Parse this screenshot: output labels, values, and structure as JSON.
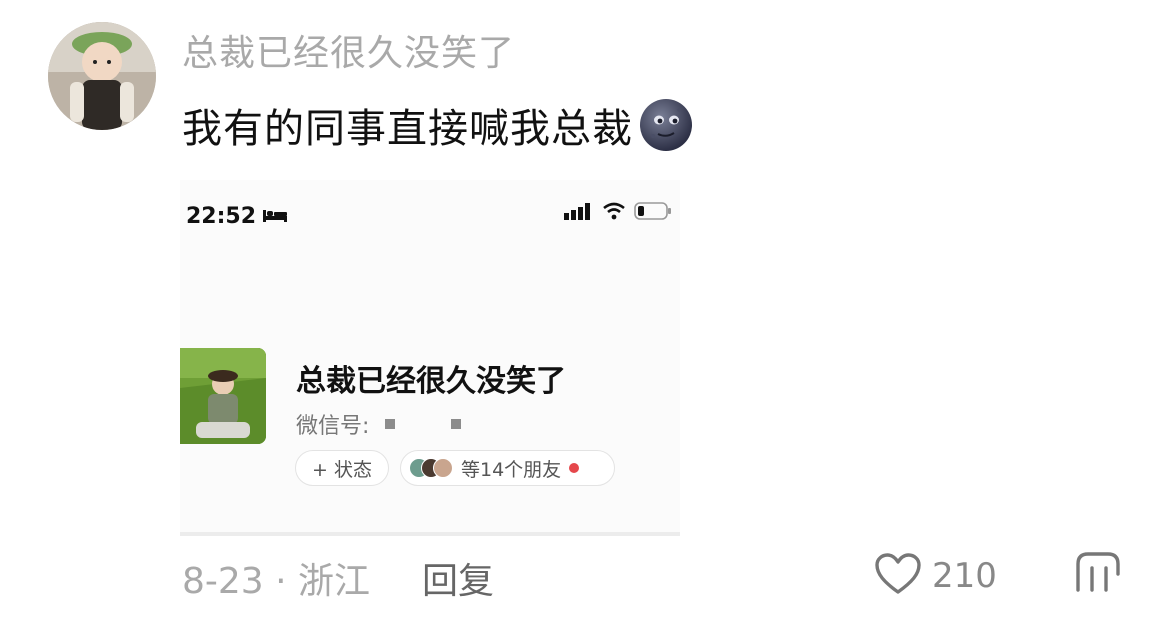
{
  "comment": {
    "username": "总裁已经很久没笑了",
    "text": "我有的同事直接喊我总裁",
    "emoji": "moon-face-emoji"
  },
  "screenshot": {
    "status_bar": {
      "time": "22:52"
    },
    "profile": {
      "name": "总裁已经很久没笑了",
      "wechat_id_label": "微信号:",
      "status_button": "+ 状态",
      "friends_text": "等14个朋友"
    }
  },
  "footer": {
    "date_location": "8-23 · 浙江",
    "reply_label": "回复",
    "like_count": "210"
  },
  "colors": {
    "muted_text": "#a9a9a9",
    "notification_dot": "#e5474b"
  }
}
